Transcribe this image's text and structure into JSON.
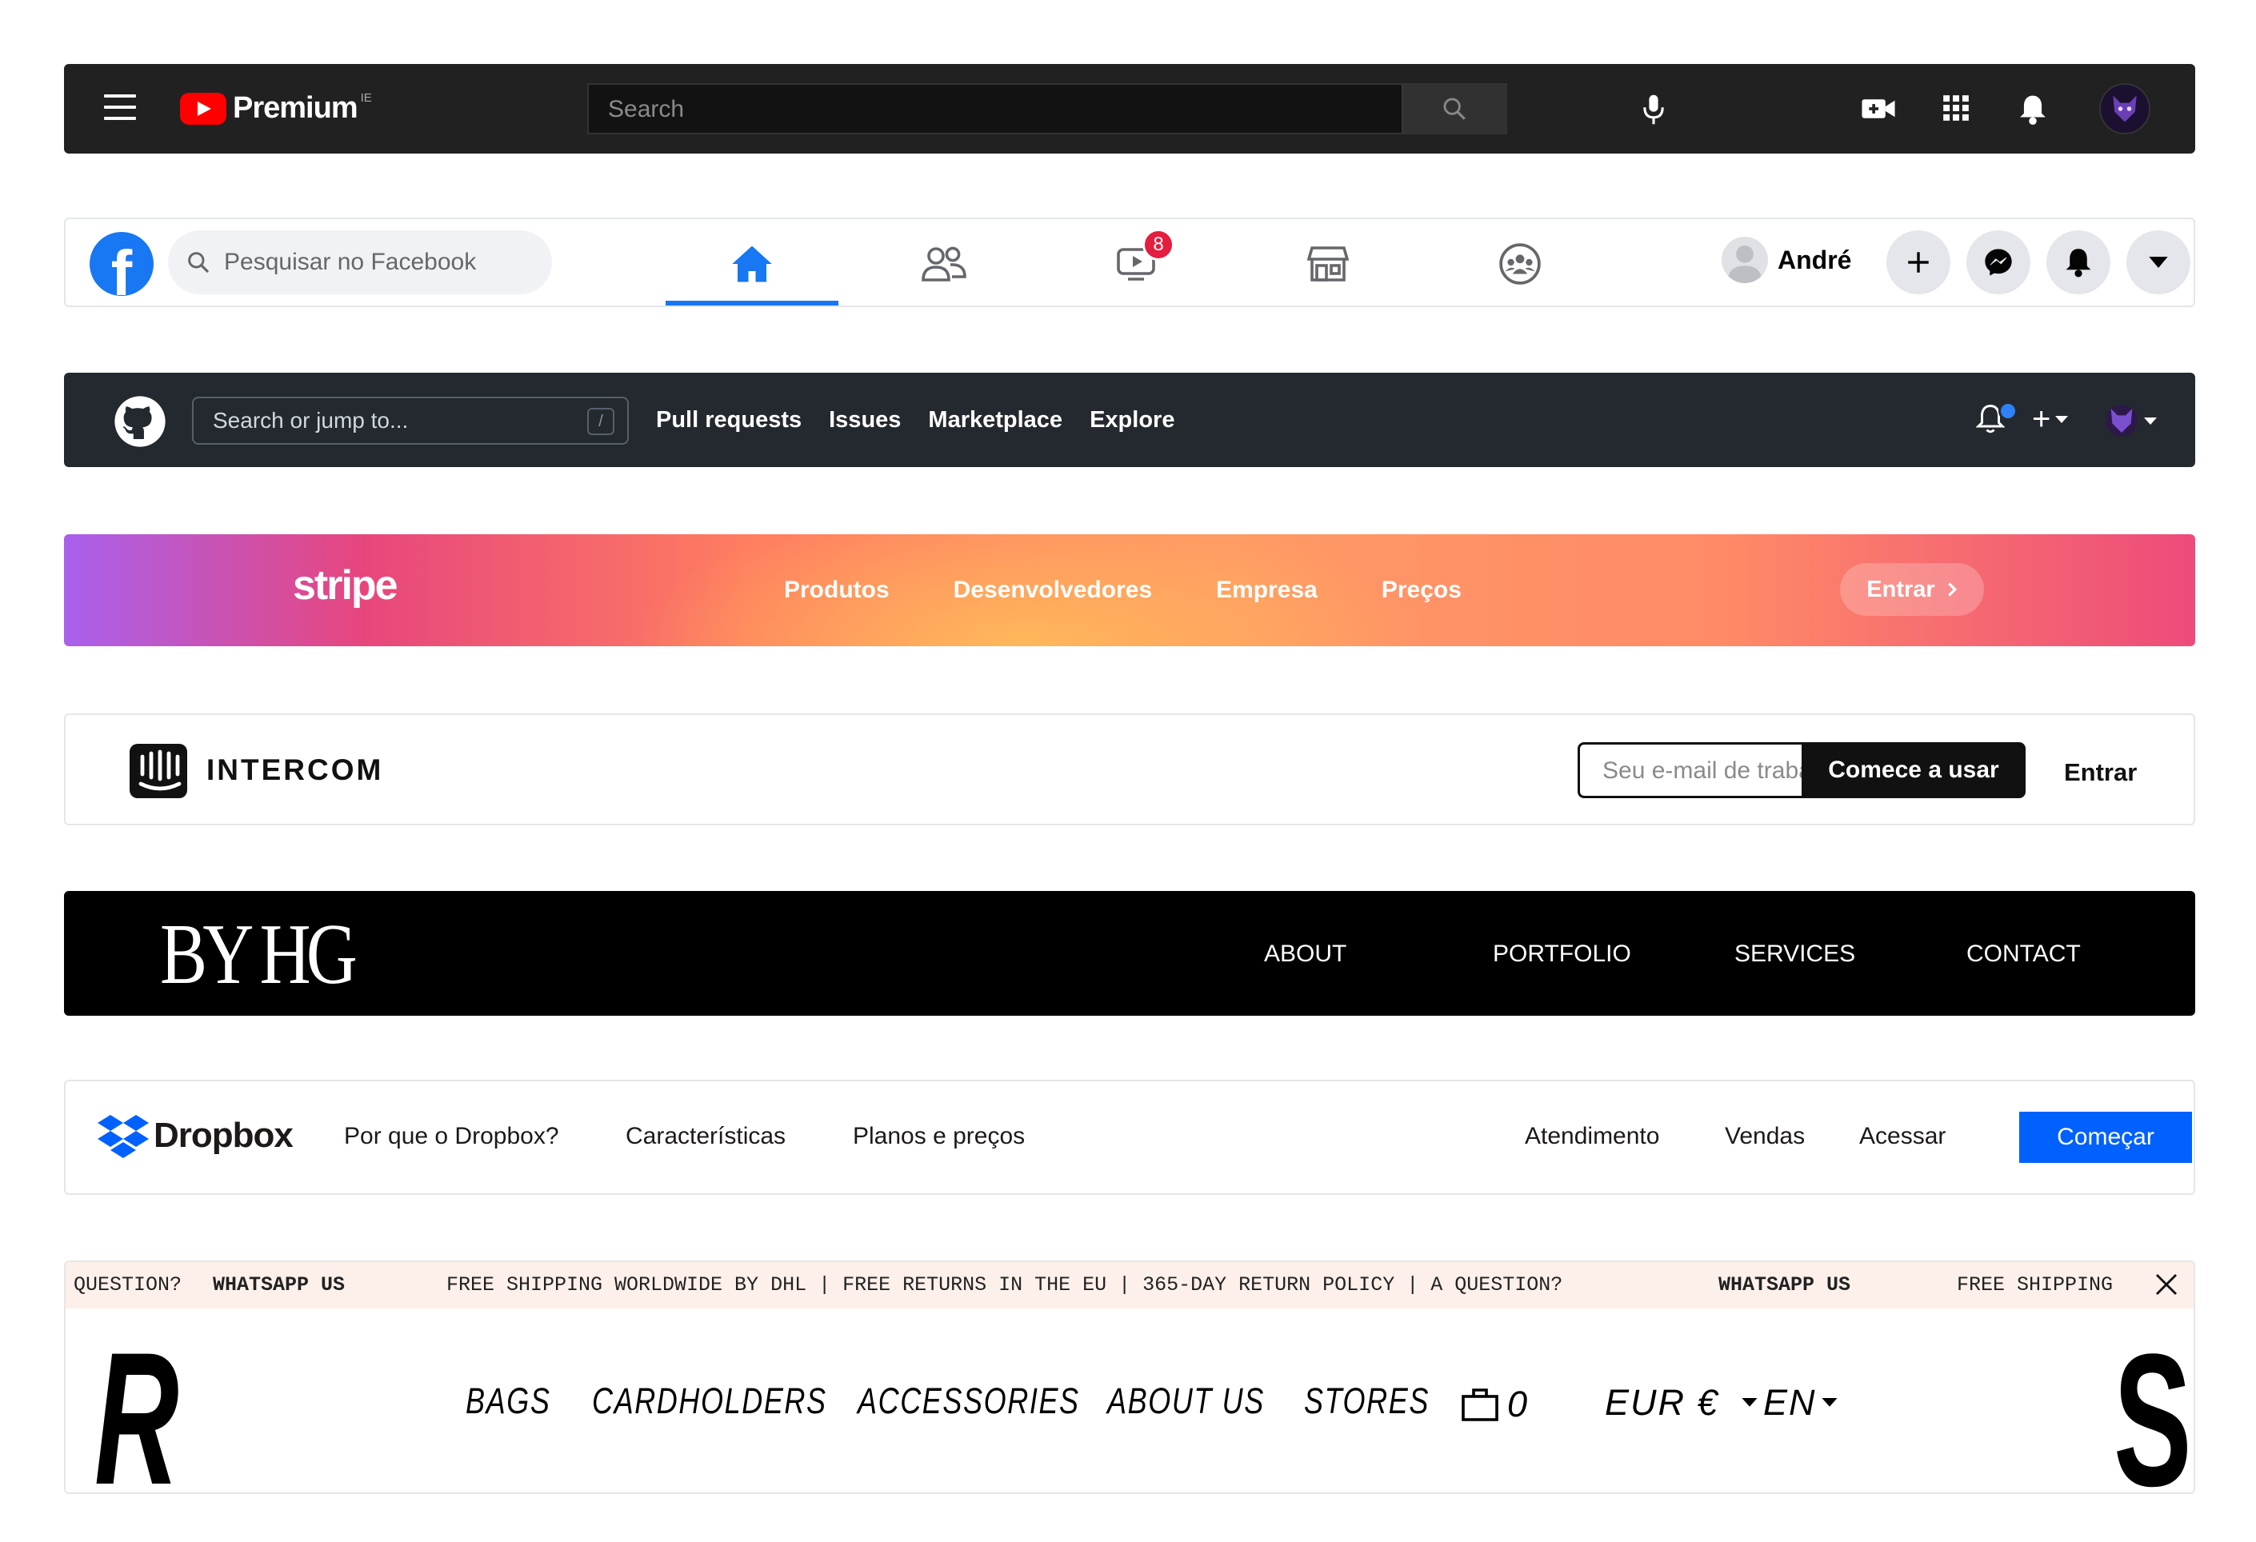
{
  "youtube": {
    "brand": "Premium",
    "country_code": "IE",
    "search_placeholder": "Search",
    "icons": [
      "menu-icon",
      "search-icon",
      "microphone-icon",
      "create-video-icon",
      "apps-grid-icon",
      "notifications-bell-icon",
      "avatar"
    ]
  },
  "facebook": {
    "search_placeholder": "Pesquisar no Facebook",
    "nav_icons": [
      "home-icon",
      "friends-icon",
      "watch-icon",
      "marketplace-icon",
      "groups-icon"
    ],
    "watch_badge": "8",
    "user_name": "André",
    "accent_color": "#1877f2"
  },
  "github": {
    "search_placeholder": "Search or jump to...",
    "search_shortcut": "/",
    "nav": [
      "Pull requests",
      "Issues",
      "Marketplace",
      "Explore"
    ],
    "plus": "+"
  },
  "stripe": {
    "logo": "stripe",
    "nav": [
      "Produtos",
      "Desenvolvedores",
      "Empresa",
      "Preços"
    ],
    "cta": "Entrar"
  },
  "intercom": {
    "brand": "INTERCOM",
    "email_placeholder": "Seu e-mail de trabalho",
    "start_button": "Comece a usar",
    "login": "Entrar"
  },
  "byhg": {
    "logo": "BY HG",
    "nav": [
      "ABOUT",
      "PORTFOLIO",
      "SERVICES",
      "CONTACT"
    ]
  },
  "dropbox": {
    "brand": "Dropbox",
    "nav_left": [
      "Por que o Dropbox?",
      "Características",
      "Planos e preços"
    ],
    "nav_right": [
      "Atendimento",
      "Vendas",
      "Acessar"
    ],
    "cta": "Começar",
    "accent_color": "#0061fe"
  },
  "shop": {
    "ticker": {
      "q1": "QUESTION?",
      "w1": "WHATSAPP US",
      "middle": "FREE SHIPPING WORLDWIDE BY DHL | FREE RETURNS IN THE EU | 365-DAY RETURN POLICY | A QUESTION?",
      "w2": "WHATSAPP US",
      "tail": "FREE SHIPPING"
    },
    "logo_left": "R",
    "logo_right": "S",
    "nav": [
      "BAGS",
      "CARDHOLDERS",
      "ACCESSORIES",
      "ABOUT US",
      "STORES"
    ],
    "cart_count": "0",
    "currency": "EUR €",
    "language": "EN"
  }
}
